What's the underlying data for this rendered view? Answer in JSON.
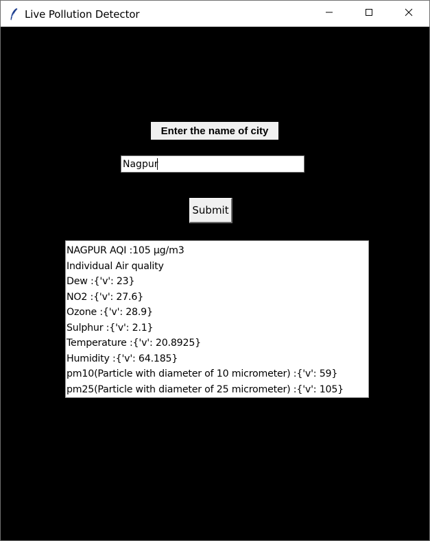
{
  "window": {
    "title": "Live Pollution Detector",
    "icon": "feather-icon",
    "controls": [
      "minimize-icon",
      "maximize-icon",
      "close-icon"
    ],
    "background": "#000000"
  },
  "form": {
    "heading": "Enter the name of city",
    "city_value": "Nagpur",
    "submit_label": "Submit"
  },
  "results": {
    "lines": [
      "NAGPUR AQI :105 µg/m3",
      "Individual Air quality",
      "Dew :{'v': 23}",
      "NO2 :{'v': 27.6}",
      "Ozone :{'v': 28.9}",
      "Sulphur :{'v': 2.1}",
      "Temperature :{'v': 20.8925}",
      "Humidity :{'v': 64.185}",
      "pm10(Particle with diameter of 10 micrometer) :{'v': 59}",
      "pm25(Particle with diameter of 25 micrometer) :{'v': 105}"
    ]
  }
}
